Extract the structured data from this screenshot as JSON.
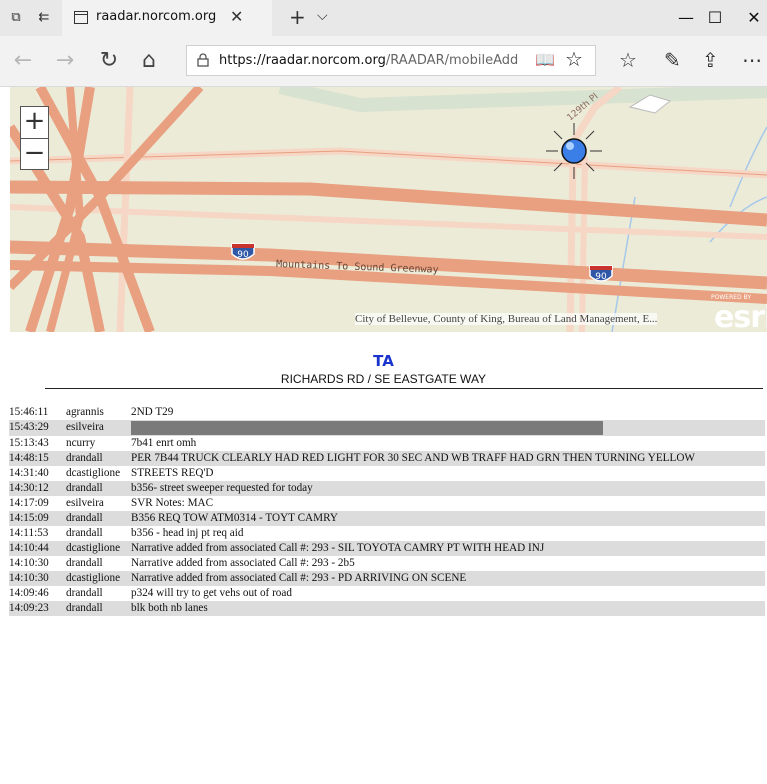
{
  "browser": {
    "tab_title": "raadar.norcom.org",
    "url_host": "https://raadar.norcom.org",
    "url_path": "/RAADAR/mobileAddrDetail.asp",
    "window_controls": {
      "minimize": "—",
      "maximize": "☐",
      "close": "✕"
    }
  },
  "map": {
    "highway_label": "Mountains To Sound Greenway",
    "shield_number": "90",
    "road_label": "129th Pl",
    "attribution": "City of Bellevue, County of King, Bureau of Land Management, E...",
    "powered_by": "POWERED BY",
    "esri": "esri",
    "zoom_in": "+",
    "zoom_out": "−"
  },
  "call": {
    "type": "TA",
    "address": "RICHARDS RD / SE EASTGATE WAY"
  },
  "log": [
    {
      "time": "15:46:11",
      "user": "agrannis",
      "text": "2ND T29",
      "redacted": false
    },
    {
      "time": "15:43:29",
      "user": "esilveira",
      "text": "",
      "redacted": true
    },
    {
      "time": "15:13:43",
      "user": "ncurry",
      "text": "7b41 enrt omh",
      "redacted": false
    },
    {
      "time": "14:48:15",
      "user": "drandall",
      "text": "PER 7B44 TRUCK CLEARLY HAD RED LIGHT FOR 30 SEC AND WB TRAFF HAD GRN THEN TURNING YELLOW",
      "redacted": false
    },
    {
      "time": "14:31:40",
      "user": "dcastiglione",
      "text": "STREETS REQ'D",
      "redacted": false
    },
    {
      "time": "14:30:12",
      "user": "drandall",
      "text": "b356- street sweeper requested for today",
      "redacted": false
    },
    {
      "time": "14:17:09",
      "user": "esilveira",
      "text": "SVR Notes: MAC",
      "redacted": false
    },
    {
      "time": "14:15:09",
      "user": "drandall",
      "text": "B356 REQ TOW ATM0314 - TOYT CAMRY",
      "redacted": false
    },
    {
      "time": "14:11:53",
      "user": "drandall",
      "text": "b356 - head inj pt req aid",
      "redacted": false
    },
    {
      "time": "14:10:44",
      "user": "dcastiglione",
      "text": "Narrative added from associated Call #: 293 - SIL TOYOTA CAMRY PT WITH HEAD INJ",
      "redacted": false
    },
    {
      "time": "14:10:30",
      "user": "drandall",
      "text": "Narrative added from associated Call #: 293 - 2b5",
      "redacted": false
    },
    {
      "time": "14:10:30",
      "user": "dcastiglione",
      "text": "Narrative added from associated Call #: 293 - PD ARRIVING ON SCENE",
      "redacted": false
    },
    {
      "time": "14:09:46",
      "user": "drandall",
      "text": "p324 will try to get vehs out of road",
      "redacted": false
    },
    {
      "time": "14:09:23",
      "user": "drandall",
      "text": "blk both nb lanes",
      "redacted": false
    }
  ],
  "colors": {
    "highway": "#e8a080",
    "map_bg": "#ecebd8",
    "call_type": "#1a33cc",
    "alt_row": "#dcdcdc"
  }
}
